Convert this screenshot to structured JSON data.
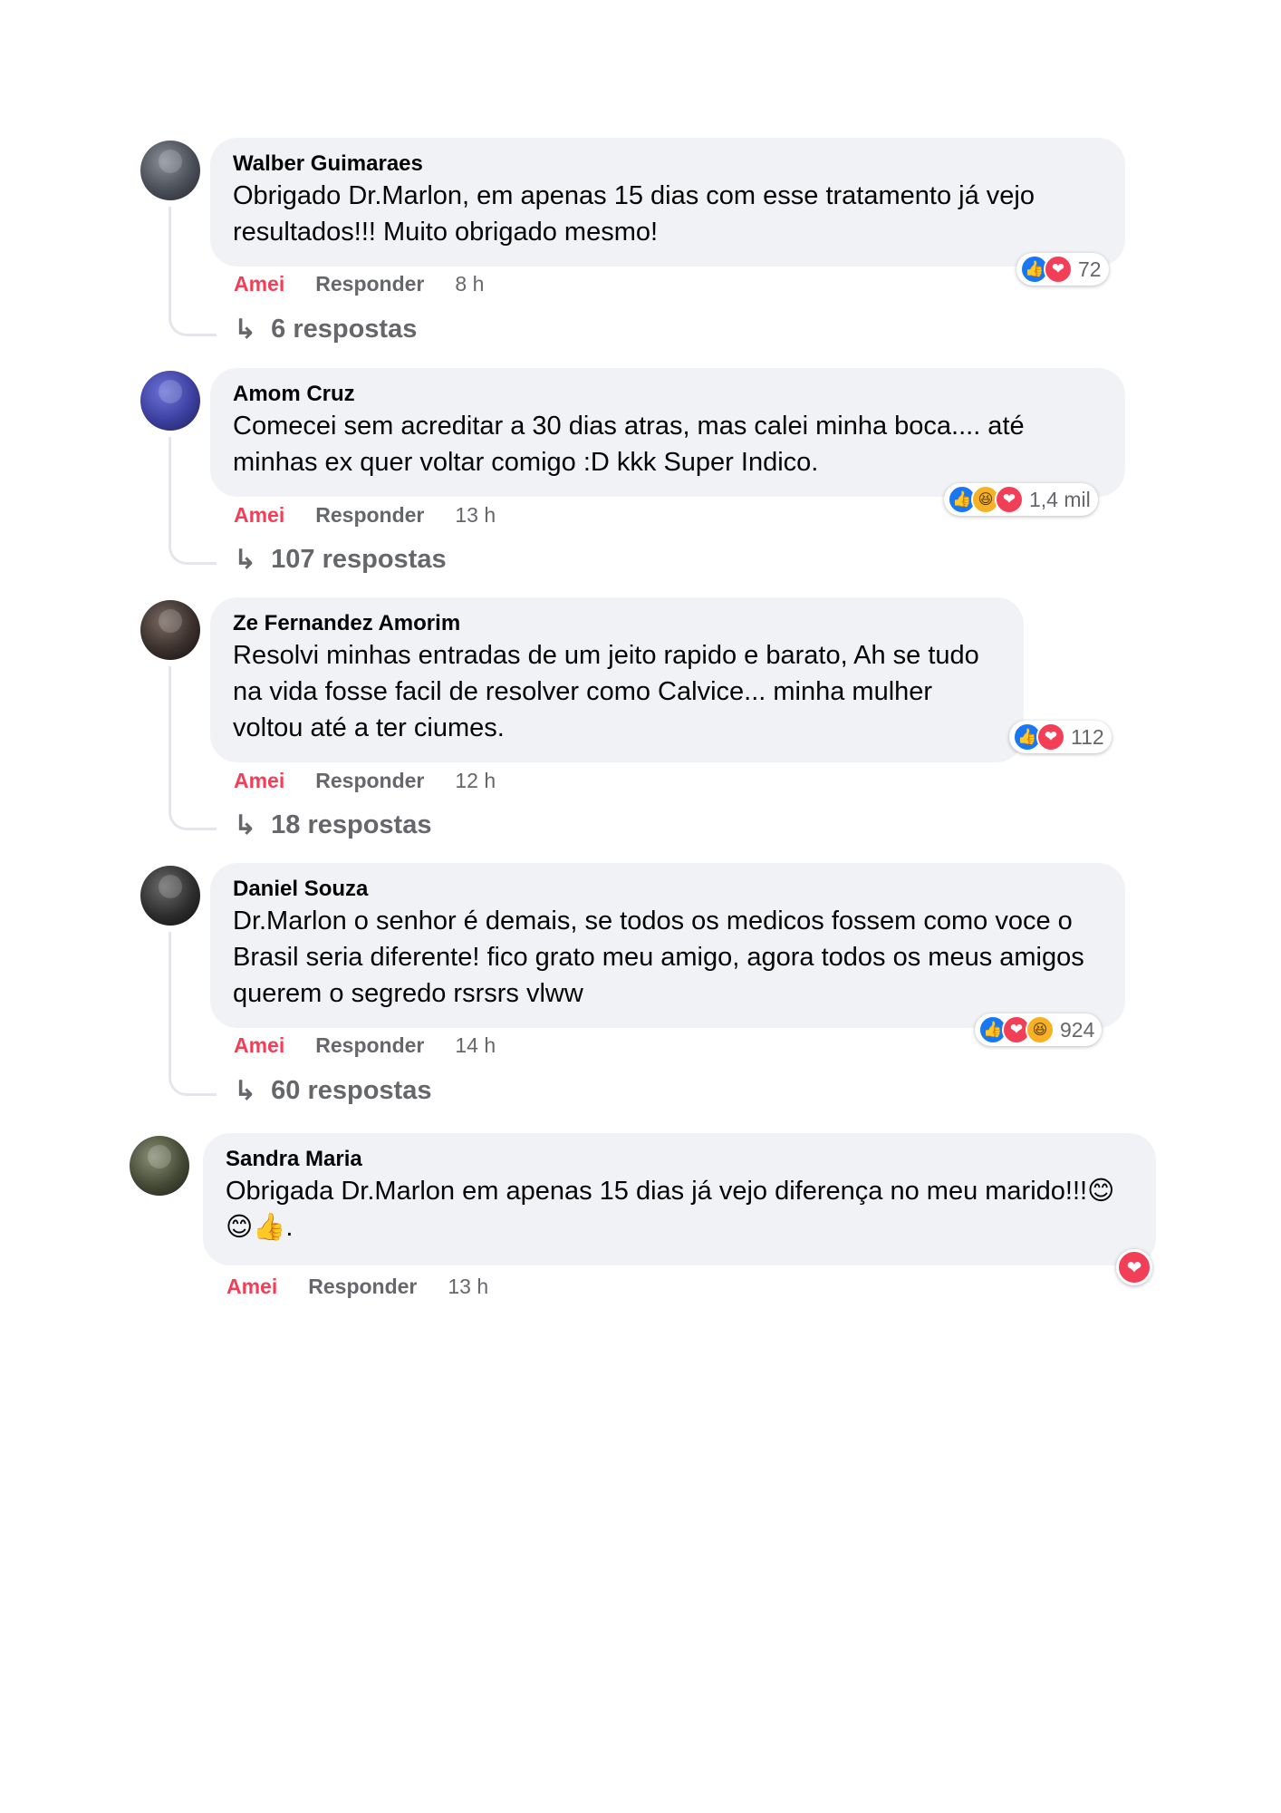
{
  "comments": [
    {
      "name": "Walber Guimaraes",
      "text": "Obrigado Dr.Marlon, em apenas 15 dias com esse tratamento já vejo resultados!!! Muito obrigado mesmo!",
      "reactions": [
        "like",
        "love"
      ],
      "reaction_count": "72",
      "like_label": "Amei",
      "reply_label": "Responder",
      "time": "8 h",
      "replies": "6 respostas"
    },
    {
      "name": "Amom Cruz",
      "text": "Comecei sem acreditar a 30 dias atras, mas calei minha boca.... até minhas ex quer voltar comigo :D kkk Super Indico.",
      "reactions": [
        "like",
        "haha",
        "love"
      ],
      "reaction_count": "1,4 mil",
      "like_label": "Amei",
      "reply_label": "Responder",
      "time": "13 h",
      "replies": "107 respostas"
    },
    {
      "name": "Ze Fernandez Amorim",
      "text": "Resolvi minhas entradas de um jeito rapido e barato, Ah se tudo na vida fosse facil de resolver como Calvice... minha mulher voltou até a ter ciumes.",
      "reactions": [
        "like",
        "love"
      ],
      "reaction_count": "112",
      "like_label": "Amei",
      "reply_label": "Responder",
      "time": "12 h",
      "replies": "18 respostas"
    },
    {
      "name": "Daniel Souza",
      "text": "Dr.Marlon o senhor é demais, se todos os medicos fossem como voce o Brasil seria diferente! fico grato meu amigo, agora todos os meus amigos querem o segredo rsrsrs vlww",
      "reactions": [
        "like",
        "love",
        "haha"
      ],
      "reaction_count": "924",
      "like_label": "Amei",
      "reply_label": "Responder",
      "time": "14 h",
      "replies": "60 respostas"
    },
    {
      "name": "Sandra Maria",
      "text": "Obrigada Dr.Marlon em apenas 15 dias já vejo diferença no meu marido!!!😊😊👍.",
      "reactions": [
        "love"
      ],
      "reaction_count": "",
      "like_label": "Amei",
      "reply_label": "Responder",
      "time": "13 h",
      "replies": ""
    }
  ],
  "icons": {
    "like": "thumbs-up-icon",
    "love": "heart-icon",
    "haha": "laughing-face-icon",
    "reply": "reply-arrow-icon"
  },
  "colors": {
    "bubble": "#f0f2f5",
    "amei": "#f33e58",
    "muted": "#65676b",
    "like": "#1877f2",
    "love": "#f33e58",
    "haha": "#f7b125"
  }
}
